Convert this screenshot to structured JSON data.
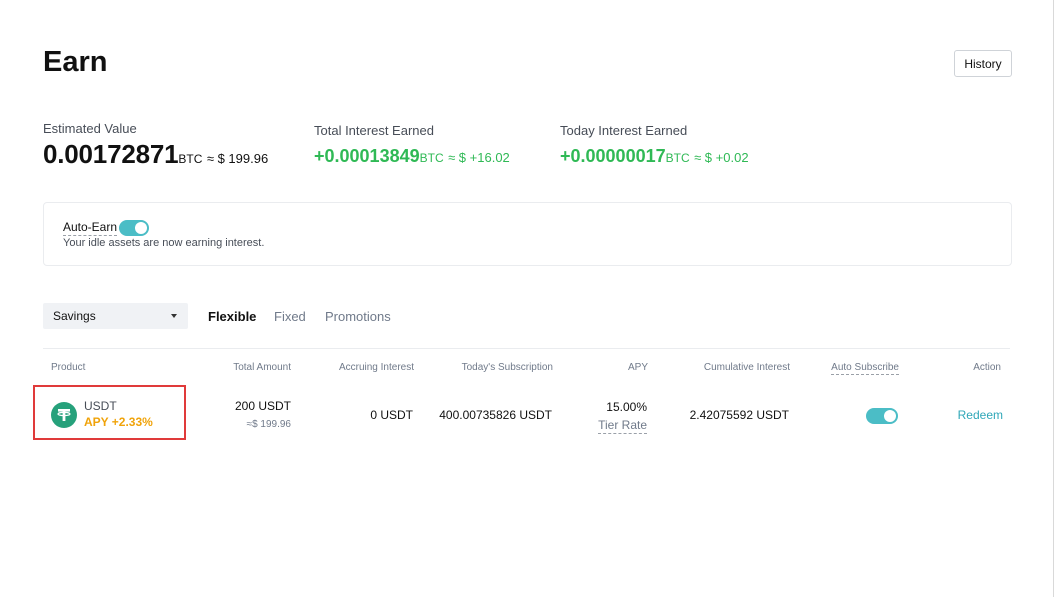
{
  "page": {
    "title": "Earn",
    "history_label": "History"
  },
  "summary": {
    "estimated": {
      "label": "Estimated Value",
      "value": "0.00172871",
      "unit": "BTC",
      "approx": "≈ $ 199.96"
    },
    "total_interest": {
      "label": "Total Interest Earned",
      "value": "+0.00013849",
      "unit": "BTC",
      "approx": "≈ $ +16.02"
    },
    "today_interest": {
      "label": "Today Interest Earned",
      "value": "+0.00000017",
      "unit": "BTC",
      "approx": "≈ $ +0.02"
    }
  },
  "auto_earn": {
    "label": "Auto-Earn",
    "enabled": true,
    "description": "Your idle assets are now earning interest."
  },
  "filters": {
    "product_select": "Savings",
    "tabs": [
      {
        "label": "Flexible",
        "active": true
      },
      {
        "label": "Fixed",
        "active": false
      },
      {
        "label": "Promotions",
        "active": false
      }
    ]
  },
  "table": {
    "headers": {
      "product": "Product",
      "total_amount": "Total Amount",
      "accruing_interest": "Accruing Interest",
      "todays_subscription": "Today's Subscription",
      "apy": "APY",
      "cumulative_interest": "Cumulative Interest",
      "auto_subscribe": "Auto Subscribe",
      "action": "Action"
    },
    "rows": [
      {
        "coin": "USDT",
        "apy_bonus": "APY +2.33%",
        "total_amount": "200 USDT",
        "total_amount_usd": "≈$ 199.96",
        "accruing_interest": "0 USDT",
        "todays_subscription": "400.00735826 USDT",
        "apy": "15.00%",
        "tier_rate_label": "Tier Rate",
        "cumulative_interest": "2.42075592 USDT",
        "auto_subscribe": true,
        "action_label": "Redeem"
      }
    ]
  },
  "colors": {
    "green": "#2fb955",
    "teal": "#4bbdc6",
    "apy_orange": "#f0a30a",
    "highlight_red": "#e03a3a",
    "tether_green": "#26a17b"
  },
  "icons": {
    "coin": "tether-icon",
    "caret": "caret-down-icon"
  }
}
